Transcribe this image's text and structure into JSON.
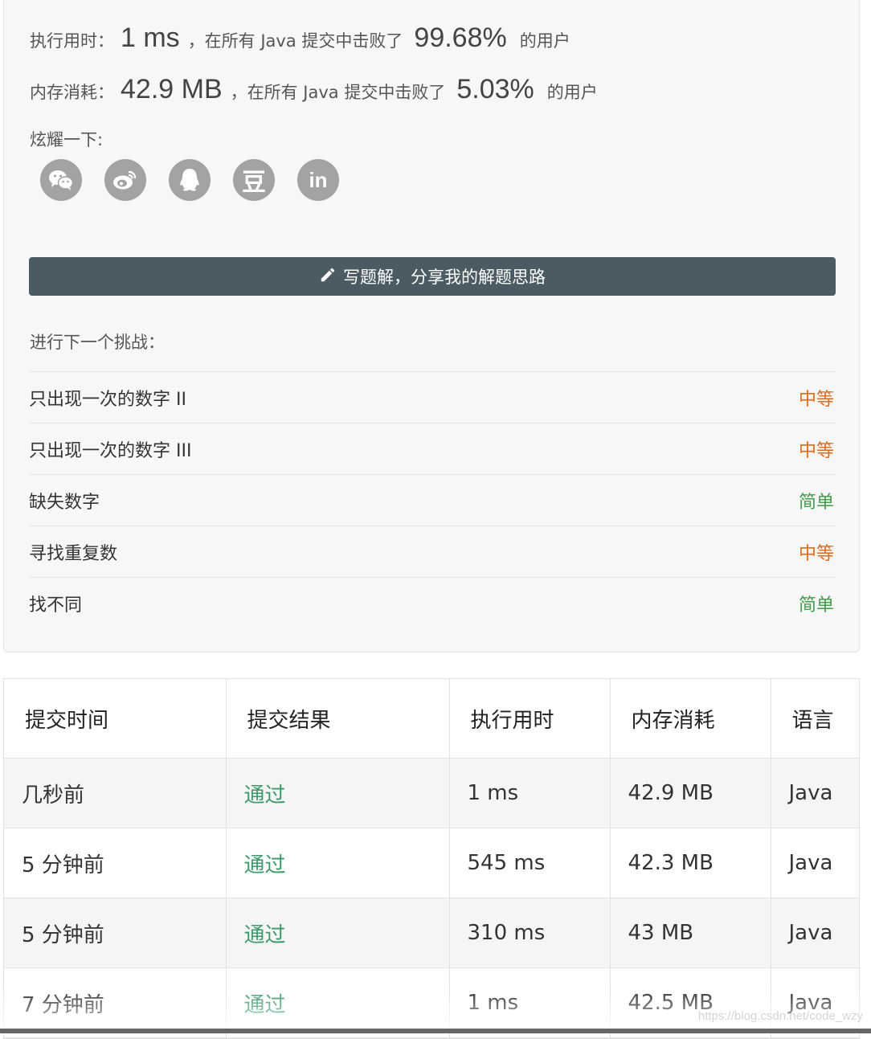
{
  "result": {
    "runtime_label": "执行用时：",
    "runtime_value": "1 ms",
    "beat_prefix": "，在所有 Java 提交中击败了",
    "runtime_pct": "99.68%",
    "beat_suffix": "的用户",
    "memory_label": "内存消耗：",
    "memory_value": "42.9 MB",
    "memory_pct": "5.03%"
  },
  "share": {
    "label": "炫耀一下:",
    "icons": [
      "wechat-icon",
      "weibo-icon",
      "qq-icon",
      "douban-icon",
      "linkedin-icon"
    ],
    "douban_glyph": "豆",
    "linkedin_glyph": "in"
  },
  "write_solution": {
    "label": "写题解，分享我的解题思路",
    "icon": "pencil-icon"
  },
  "next_challenge": {
    "label": "进行下一个挑战：",
    "items": [
      {
        "title": "只出现一次的数字 II",
        "difficulty": "中等",
        "color": "#e06a1b"
      },
      {
        "title": "只出现一次的数字 III",
        "difficulty": "中等",
        "color": "#e06a1b"
      },
      {
        "title": "缺失数字",
        "difficulty": "简单",
        "color": "#3f9c4b"
      },
      {
        "title": "寻找重复数",
        "difficulty": "中等",
        "color": "#e06a1b"
      },
      {
        "title": "找不同",
        "difficulty": "简单",
        "color": "#3f9c4b"
      }
    ]
  },
  "submissions": {
    "headers": [
      "提交时间",
      "提交结果",
      "执行用时",
      "内存消耗",
      "语言"
    ],
    "rows": [
      [
        "几秒前",
        "通过",
        "1 ms",
        "42.9 MB",
        "Java"
      ],
      [
        "5 分钟前",
        "通过",
        "545 ms",
        "42.3 MB",
        "Java"
      ],
      [
        "5 分钟前",
        "通过",
        "310 ms",
        "43 MB",
        "Java"
      ],
      [
        "7 分钟前",
        "通过",
        "1 ms",
        "42.5 MB",
        "Java"
      ]
    ],
    "status_color": "#3b9a6b"
  },
  "watermark": "https://blog.csdn.net/code_wzy"
}
